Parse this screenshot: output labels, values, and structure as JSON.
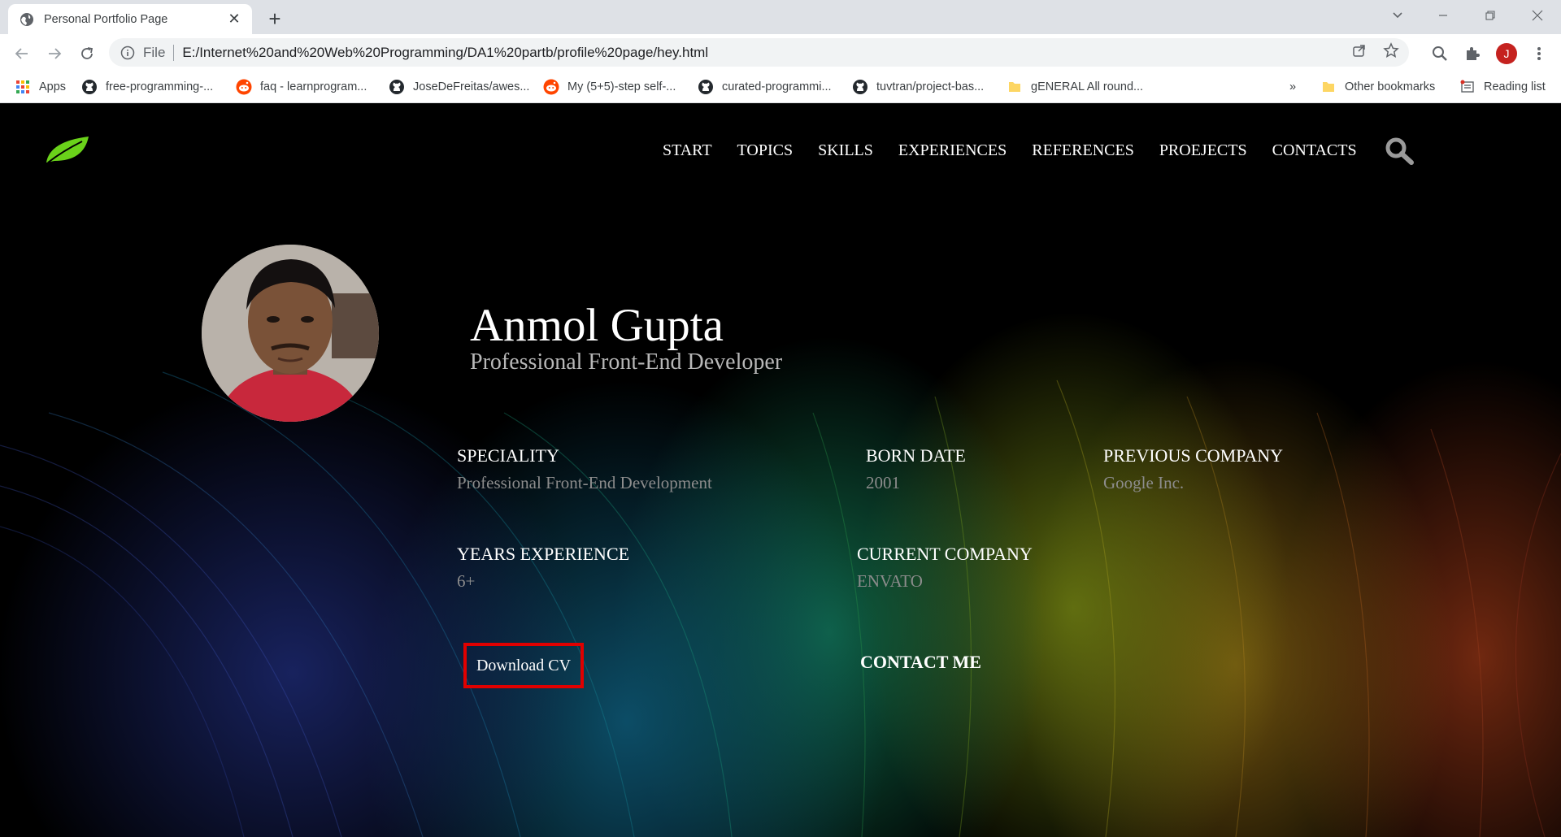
{
  "browser": {
    "tab_title": "Personal Portfolio Page",
    "url_scheme": "File",
    "url": "E:/Internet%20and%20Web%20Programming/DA1%20partb/profile%20page/hey.html",
    "profile_initial": "J",
    "bookmarks": [
      {
        "label": "Apps",
        "icon": "apps-grid-icon"
      },
      {
        "label": "free-programming-...",
        "icon": "github-icon"
      },
      {
        "label": "faq - learnprogram...",
        "icon": "reddit-icon"
      },
      {
        "label": "JoseDeFreitas/awes...",
        "icon": "github-icon"
      },
      {
        "label": "My (5+5)-step self-...",
        "icon": "reddit-icon"
      },
      {
        "label": "curated-programmi...",
        "icon": "github-icon"
      },
      {
        "label": "tuvtran/project-bas...",
        "icon": "github-icon"
      },
      {
        "label": "gENERAL All round...",
        "icon": "folder-icon"
      }
    ],
    "overflow_label": "»",
    "other_bookmarks": "Other bookmarks",
    "reading_list": "Reading list"
  },
  "nav": {
    "items": [
      "START",
      "TOPICS",
      "SKILLS",
      "EXPERIENCES",
      "REFERENCES",
      "PROEJECTS",
      "CONTACTS"
    ]
  },
  "hero": {
    "name": "Anmol Gupta",
    "role": "Professional Front-End Developer"
  },
  "info": {
    "speciality_label": "SPECIALITY",
    "speciality_value": "Professional Front-End Development",
    "born_label": "BORN DATE",
    "born_value": "2001",
    "prev_company_label": "PREVIOUS COMPANY",
    "prev_company_value": "Google Inc.",
    "years_label": "YEARS EXPERIENCE",
    "years_value": "6+",
    "current_company_label": "CURRENT COMPANY",
    "current_company_value": "ENVATO"
  },
  "actions": {
    "download_cv": "Download CV",
    "contact_me": "CONTACT ME"
  },
  "colors": {
    "logo_green": "#6ad21a",
    "cv_border": "#e00000",
    "avatar_red": "#c5221f"
  }
}
